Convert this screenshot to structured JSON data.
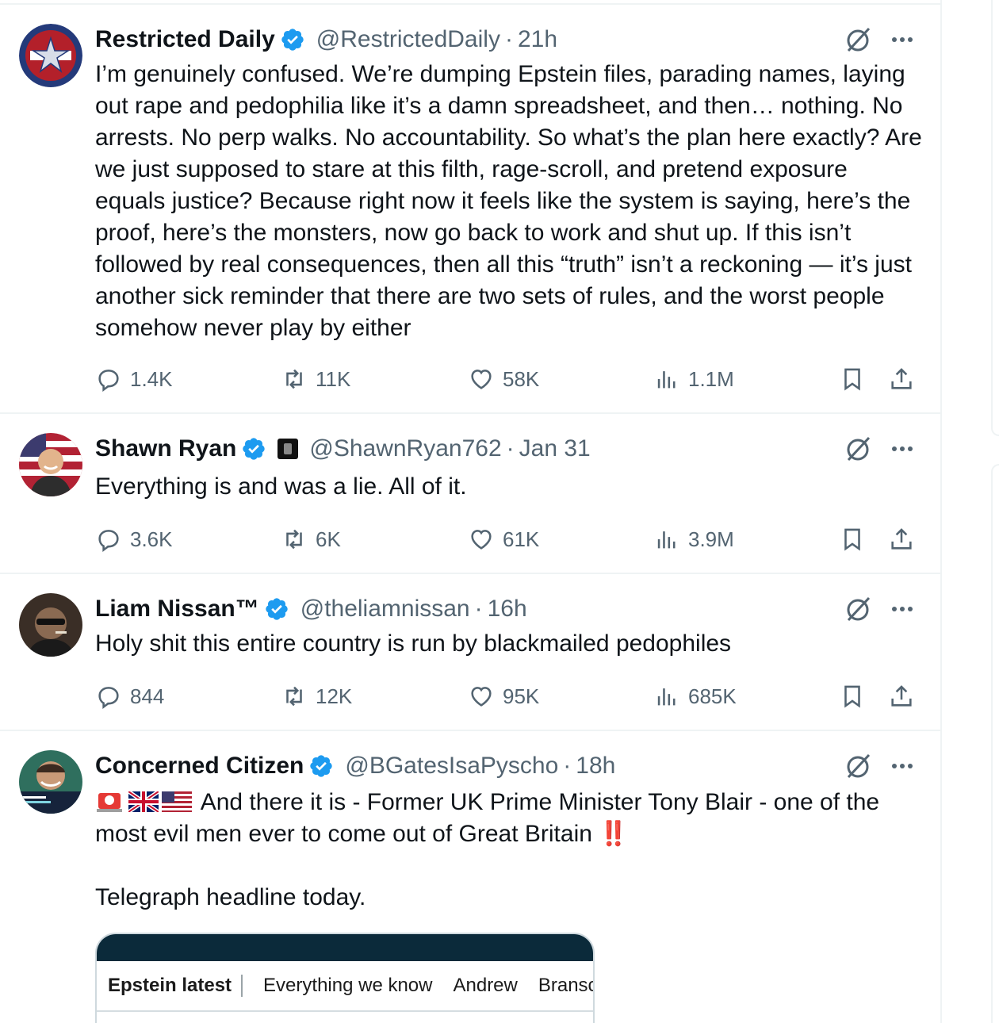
{
  "tweets": [
    {
      "name": "Restricted Daily",
      "handle": "@RestrictedDaily",
      "time": "21h",
      "text": "I’m genuinely confused. We’re dumping Epstein files, parading names, laying out rape and pedophilia like it’s a damn spreadsheet, and then… nothing. No arrests. No perp walks. No accountability. So what’s the plan here exactly? Are we just supposed to stare at this filth, rage-scroll, and pretend exposure equals justice? Because right now it feels like the system is saying, here’s the proof, here’s the monsters, now go back to work and shut up. If this isn’t followed by real consequences, then all this “truth” isn’t a reckoning — it’s just another sick reminder that there are two sets of rules, and the worst people somehow never play by either",
      "replies": "1.4K",
      "reposts": "11K",
      "likes": "58K",
      "views": "1.1M"
    },
    {
      "name": "Shawn Ryan",
      "handle": "@ShawnRyan762",
      "time": "Jan 31",
      "text": "Everything is and was a lie. All of it.",
      "replies": "3.6K",
      "reposts": "6K",
      "likes": "61K",
      "views": "3.9M"
    },
    {
      "name": "Liam Nissan™",
      "handle": "@theliamnissan",
      "time": "16h",
      "text": "Holy shit this entire country is run by blackmailed pedophiles",
      "replies": "844",
      "reposts": "12K",
      "likes": "95K",
      "views": "685K"
    },
    {
      "name": "Concerned Citizen",
      "handle": "@BGatesIsaPyscho",
      "time": "18h",
      "text_line1": "And there it is - Former UK Prime Minister Tony Blair - one of the",
      "text_line2": "most evil men ever to come out of Great Britain",
      "text_line3": "Telegraph headline today.",
      "bang": "‼️",
      "card_tabs": [
        "Epstein latest",
        "Everything we know",
        "Andrew",
        "Bransc"
      ]
    }
  ],
  "sep": "·",
  "colors": {
    "verified": "#1d9bf0",
    "muted": "#536471",
    "text": "#0f1419",
    "divider": "#eff3f4"
  },
  "icons": [
    "verified-badge-icon",
    "grok-icon",
    "more-icon",
    "reply-icon",
    "repost-icon",
    "like-icon",
    "views-icon",
    "bookmark-icon",
    "share-icon"
  ]
}
